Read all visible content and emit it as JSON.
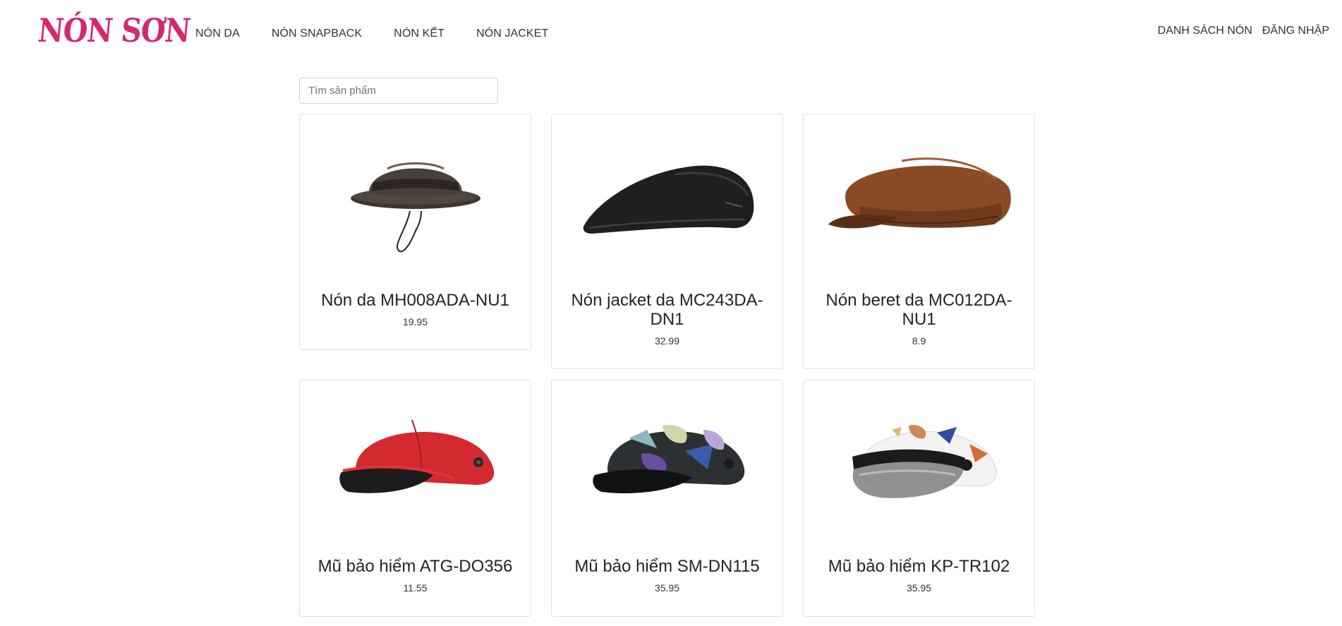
{
  "brand": {
    "name": "NÓN SƠN",
    "color": "#d6286b"
  },
  "nav": {
    "left": [
      {
        "label": "NÓN DA"
      },
      {
        "label": "NÓN SNAPBACK"
      },
      {
        "label": "NÓN KẾT"
      },
      {
        "label": "NÓN JACKET"
      }
    ],
    "right": [
      {
        "label": "DANH SÁCH NÓN"
      },
      {
        "label": "ĐĂNG NHẬP"
      }
    ]
  },
  "search": {
    "placeholder": "Tìm sản phẩm",
    "value": ""
  },
  "products": [
    {
      "name": "Nón da MH008ADA-NU1",
      "price": "19.95",
      "icon": "bucket-hat"
    },
    {
      "name": "Nón jacket da MC243DA-DN1",
      "price": "32.99",
      "icon": "flat-cap"
    },
    {
      "name": "Nón beret da MC012DA-NU1",
      "price": "8.9",
      "icon": "newsboy-cap"
    },
    {
      "name": "Mũ bảo hiểm ATG-DO356",
      "price": "11.55",
      "icon": "red-helmet"
    },
    {
      "name": "Mũ bảo hiểm SM-DN115",
      "price": "35.95",
      "icon": "patterned-helmet"
    },
    {
      "name": "Mũ bảo hiểm KP-TR102",
      "price": "35.95",
      "icon": "white-visor-helmet"
    }
  ]
}
